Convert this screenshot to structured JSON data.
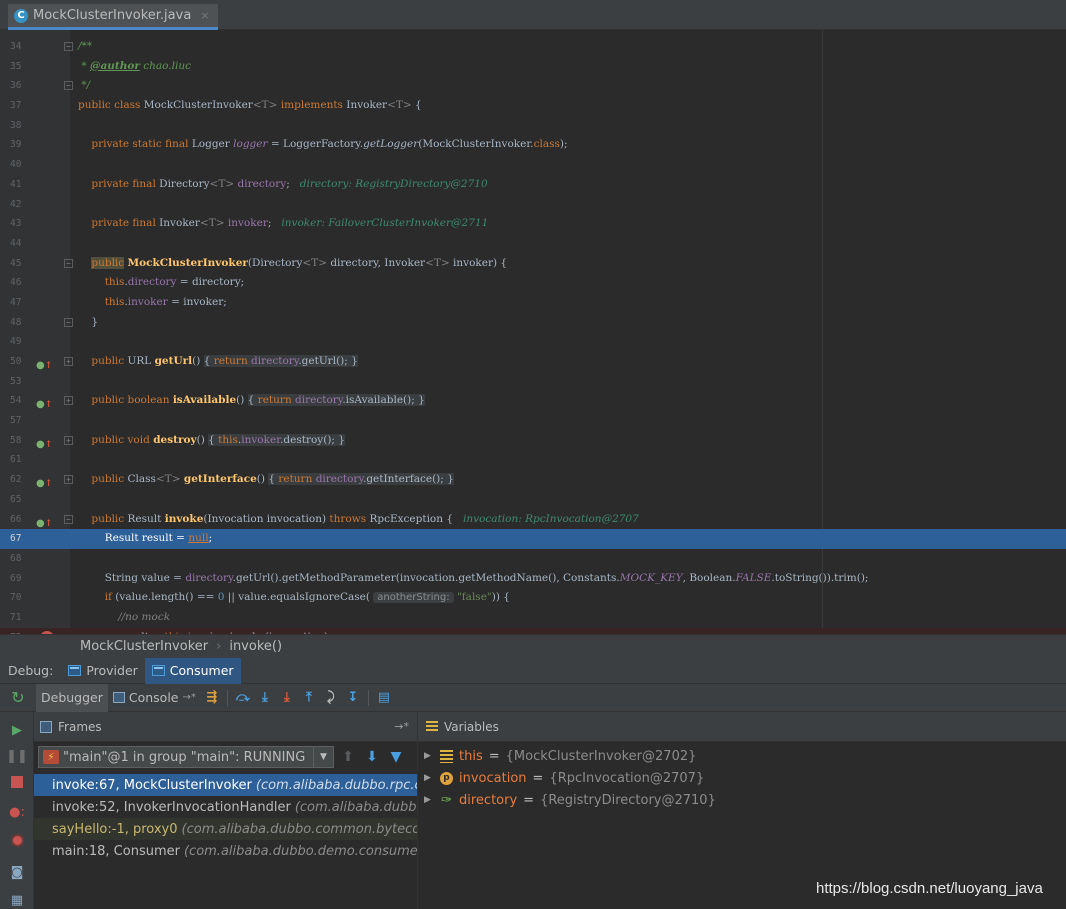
{
  "editor_tab": {
    "icon_letter": "C",
    "filename": "MockClusterInvoker.java",
    "close_glyph": "×"
  },
  "code_lines": [
    {
      "num": "34",
      "fold": "-",
      "html": "<span class=\"cmt\">/**</span>"
    },
    {
      "num": "35",
      "html": "<span class=\"cmt\"> * </span><span class=\"tag\">@author</span><span class=\"cmt\"> chao.liuc</span>"
    },
    {
      "num": "36",
      "fold": "-",
      "html": "<span class=\"cmt\"> */</span>"
    },
    {
      "num": "37",
      "html": "<span class=\"kw\">public class</span> MockClusterInvoker<span class=\"gray\">&lt;T&gt;</span> <span class=\"kw\">implements</span> Invoker<span class=\"gray\">&lt;T&gt;</span> {"
    },
    {
      "num": "38",
      "html": ""
    },
    {
      "num": "39",
      "html": "    <span class=\"kw\">private static final</span> Logger <span class=\"fld ital\">logger</span> = LoggerFactory.<span class=\"ital\">getLogger</span>(MockClusterInvoker.<span class=\"kw\">class</span>);"
    },
    {
      "num": "40",
      "html": ""
    },
    {
      "num": "41",
      "html": "    <span class=\"kw\">private final</span> Directory<span class=\"gray\">&lt;T&gt;</span> <span class=\"fld\">directory</span>;<span class=\"hint\">directory: RegistryDirectory@2710</span>"
    },
    {
      "num": "42",
      "html": ""
    },
    {
      "num": "43",
      "html": "    <span class=\"kw\">private final</span> Invoker<span class=\"gray\">&lt;T&gt;</span> <span class=\"fld\">invoker</span>;<span class=\"hint\">invoker: FailoverClusterInvoker@2711</span>"
    },
    {
      "num": "44",
      "html": ""
    },
    {
      "num": "45",
      "fold": "-",
      "html": "    <span class=\"kw pub-hl\">public</span> <span class=\"fn\">MockClusterInvoker</span>(Directory<span class=\"gray\">&lt;T&gt;</span> directory, Invoker<span class=\"gray\">&lt;T&gt;</span> invoker) {"
    },
    {
      "num": "46",
      "html": "        <span class=\"kw\">this</span>.<span class=\"fld\">directory</span> = directory;"
    },
    {
      "num": "47",
      "html": "        <span class=\"kw\">this</span>.<span class=\"fld\">invoker</span> = invoker;"
    },
    {
      "num": "48",
      "fold": "-",
      "html": "    }"
    },
    {
      "num": "49",
      "html": ""
    },
    {
      "num": "50",
      "over": true,
      "fold": "+",
      "html": "    <span class=\"kw\">public</span> URL <span class=\"fn\">getUrl</span>() <span class=\"fold-box\">{ <span class=\"kw\">return</span> <span class=\"fld\">directory</span>.getUrl(); }</span>"
    },
    {
      "num": "53",
      "html": ""
    },
    {
      "num": "54",
      "over": true,
      "fold": "+",
      "html": "    <span class=\"kw\">public boolean</span> <span class=\"fn\">isAvailable</span>() <span class=\"fold-box\">{ <span class=\"kw\">return</span> <span class=\"fld\">directory</span>.isAvailable(); }</span>"
    },
    {
      "num": "57",
      "html": ""
    },
    {
      "num": "58",
      "over": true,
      "fold": "+",
      "html": "    <span class=\"kw\">public void</span> <span class=\"fn\">destroy</span>() <span class=\"fold-box\">{ <span class=\"kw\">this</span>.<span class=\"fld\">invoker</span>.destroy(); }</span>"
    },
    {
      "num": "61",
      "html": ""
    },
    {
      "num": "62",
      "over": true,
      "fold": "+",
      "html": "    <span class=\"kw\">public</span> Class<span class=\"gray\">&lt;T&gt;</span> <span class=\"fn\">getInterface</span>() <span class=\"fold-box\">{ <span class=\"kw\">return</span> <span class=\"fld\">directory</span>.getInterface(); }</span>"
    },
    {
      "num": "65",
      "html": ""
    },
    {
      "num": "66",
      "over": true,
      "fold": "-",
      "html": "    <span class=\"kw\">public</span> Result <span class=\"fn\">invoke</span>(Invocation invocation) <span class=\"kw\">throws</span> RpcException {<span class=\"hint\">invocation: RpcInvocation@2707</span>"
    },
    {
      "num": "67",
      "hl": true,
      "html": "        Result result = <span class=\"null-kw\">null</span>;"
    },
    {
      "num": "68",
      "html": ""
    },
    {
      "num": "69",
      "html": "        String value = <span class=\"fld\">directory</span>.getUrl().getMethodParameter(invocation.getMethodName(), Constants.<span class=\"fld ital\">MOCK_KEY</span>, Boolean.<span class=\"fld ital\">FALSE</span>.toString()).trim();"
    },
    {
      "num": "70",
      "html": "        <span class=\"kw\">if</span> (value.length() == <span class=\"num\">0</span> || value.equalsIgnoreCase( <span class=\"param-hint\">anotherString:</span> <span class=\"str\">\"false\"</span>)) {"
    },
    {
      "num": "71",
      "html": "            <span class=\"gray ital\">//no mock</span>"
    },
    {
      "num": "72",
      "bp": true,
      "html": "            result = <span class=\"kw\">this</span>.<span class=\"fld\">invoker</span>.invoke(invocation);"
    }
  ],
  "breadcrumb": {
    "class_name": "MockClusterInvoker",
    "separator": "›",
    "method": "invoke()"
  },
  "debug": {
    "title": "Debug:",
    "tabs": [
      "Provider",
      "Consumer"
    ],
    "toolbar": {
      "debugger_label": "Debugger",
      "console_label": "Console",
      "pin": "→*"
    },
    "frames": {
      "header": "Frames",
      "pin": "→*",
      "thread": "\"main\"@1 in group \"main\": RUNNING",
      "items": [
        {
          "method": "invoke:67, MockClusterInvoker",
          "pkg": "(com.alibaba.dubbo.rpc.clust"
        },
        {
          "method": "invoke:52, InvokerInvocationHandler",
          "pkg": "(com.alibaba.dubbo.rpc"
        },
        {
          "method": "sayHello:-1, proxy0",
          "pkg": "(com.alibaba.dubbo.common.bytecode)"
        },
        {
          "method": "main:18, Consumer",
          "pkg": "(com.alibaba.dubbo.demo.consumer)"
        }
      ]
    },
    "variables": {
      "header": "Variables",
      "items": [
        {
          "name": "this",
          "value": "{MockClusterInvoker@2702}"
        },
        {
          "name": "invocation",
          "value": "{RpcInvocation@2707}"
        },
        {
          "name": "directory",
          "value": "{RegistryDirectory@2710}"
        }
      ]
    }
  },
  "watermark": "https://blog.csdn.net/luoyang_java"
}
